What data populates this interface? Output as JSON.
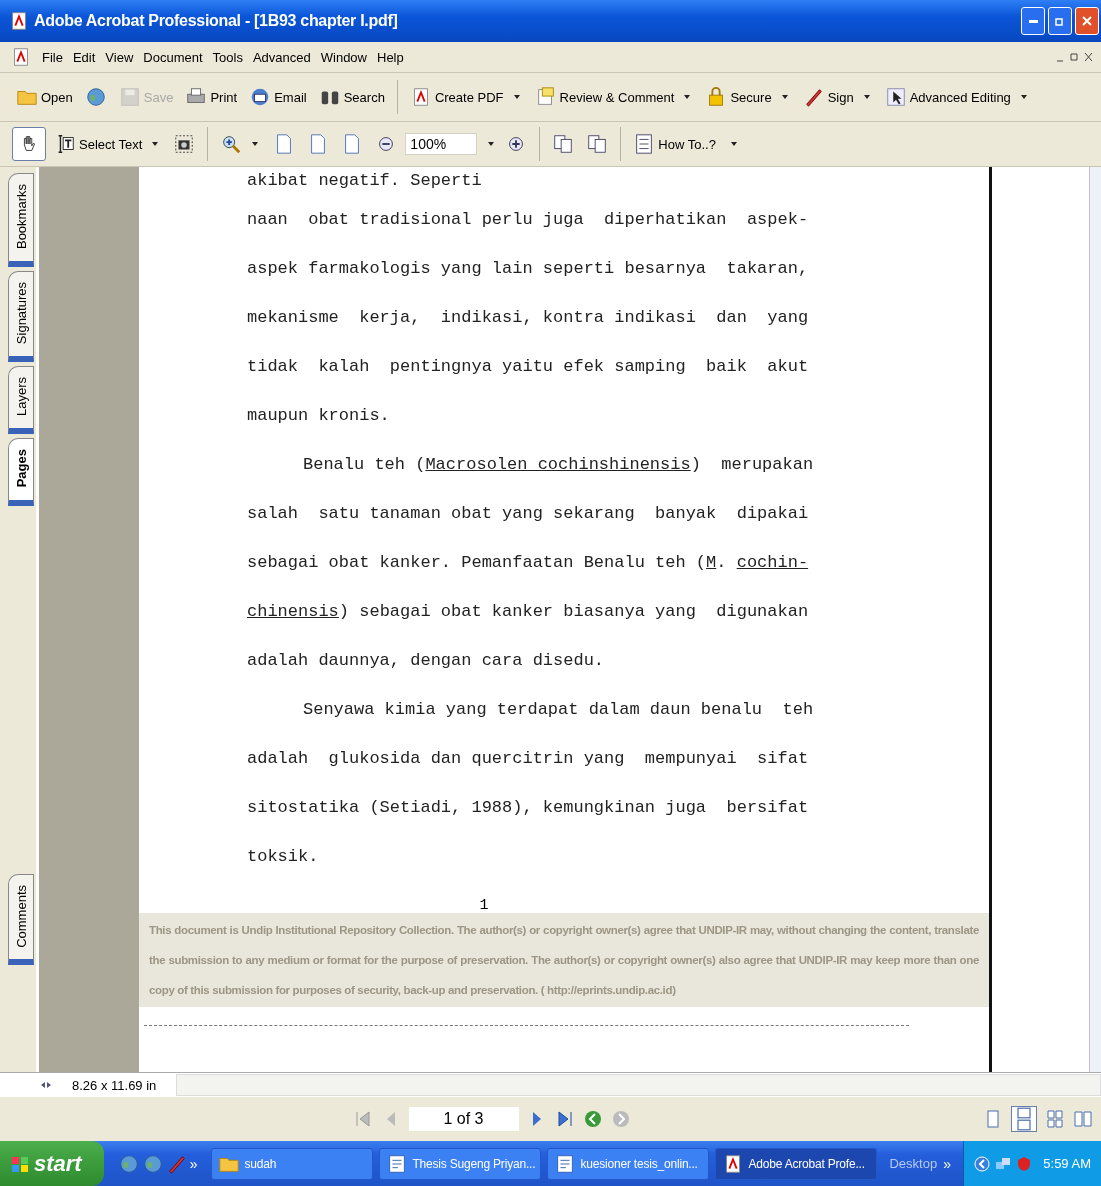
{
  "window": {
    "title": "Adobe Acrobat Professional - [1B93 chapter I.pdf]"
  },
  "menu": [
    "File",
    "Edit",
    "View",
    "Document",
    "Tools",
    "Advanced",
    "Window",
    "Help"
  ],
  "toolbar": [
    {
      "label": "Open",
      "disabled": false,
      "dropdown": false
    },
    {
      "disabled": false,
      "dropdown": false
    },
    {
      "label": "Save",
      "disabled": true,
      "dropdown": false
    },
    {
      "label": "Print",
      "disabled": false,
      "dropdown": false
    },
    {
      "label": "Email",
      "disabled": false,
      "dropdown": false
    },
    {
      "label": "Search",
      "disabled": false,
      "dropdown": false
    },
    {
      "label": "Create PDF",
      "disabled": false,
      "dropdown": true
    },
    {
      "label": "Review & Comment",
      "disabled": false,
      "dropdown": true
    },
    {
      "label": "Secure",
      "disabled": false,
      "dropdown": true
    },
    {
      "label": "Sign",
      "disabled": false,
      "dropdown": true
    },
    {
      "label": "Advanced Editing",
      "disabled": false,
      "dropdown": true
    }
  ],
  "tools": [
    {
      "selected": true,
      "dropdown": false
    },
    {
      "label": "Select Text",
      "selected": false,
      "dropdown": true
    },
    {
      "selected": false,
      "dropdown": false
    },
    {
      "selected": false,
      "dropdown": true
    },
    {
      "selected": false,
      "dropdown": false
    },
    {
      "selected": false,
      "dropdown": false
    },
    {
      "selected": false,
      "dropdown": false
    },
    {
      "selected": false,
      "dropdown": false
    }
  ],
  "zoom": {
    "value": "100%"
  },
  "how_to": {
    "label": "How To..?"
  },
  "side_tabs": [
    {
      "label": "Bookmarks",
      "selected": false
    },
    {
      "label": "Signatures",
      "selected": false
    },
    {
      "label": "Layers",
      "selected": false
    },
    {
      "label": "Pages",
      "selected": true
    },
    {
      "label": "Comments",
      "selected": false
    }
  ],
  "document": {
    "lines": [
      {
        "indent": false,
        "parts": [
          {
            "text": "akibat negatif. Seperti",
            "underlined": false
          }
        ]
      },
      {
        "indent": false,
        "parts": [
          {
            "text": "naan  obat tradisional perlu juga  diperhatikan  aspek-",
            "underlined": false
          }
        ]
      },
      {
        "indent": false,
        "parts": [
          {
            "text": "aspek farmakologis yang lain seperti besarnya  takaran,",
            "underlined": false
          }
        ]
      },
      {
        "indent": false,
        "parts": [
          {
            "text": "mekanisme  kerja,  indikasi, kontra indikasi  dan  yang",
            "underlined": false
          }
        ]
      },
      {
        "indent": false,
        "parts": [
          {
            "text": "tidak  kalah  pentingnya yaitu efek samping  baik  akut",
            "underlined": false
          }
        ]
      },
      {
        "indent": false,
        "parts": [
          {
            "text": "maupun kronis.",
            "underlined": false
          }
        ]
      },
      {
        "indent": true,
        "parts": [
          {
            "text": "Benalu teh (",
            "underlined": false
          },
          {
            "text": "Macrosolen cochinshinensis",
            "underlined": true
          },
          {
            "text": ")  merupakan",
            "underlined": false
          }
        ]
      },
      {
        "indent": false,
        "parts": [
          {
            "text": "salah  satu tanaman obat yang sekarang  banyak  dipakai",
            "underlined": false
          }
        ]
      },
      {
        "indent": false,
        "parts": [
          {
            "text": "sebagai obat kanker. Pemanfaatan Benalu teh (",
            "underlined": false
          },
          {
            "text": "M",
            "underlined": true
          },
          {
            "text": ". ",
            "underlined": false
          },
          {
            "text": "cochin-",
            "underlined": true
          }
        ]
      },
      {
        "indent": false,
        "parts": [
          {
            "text": "chinensis",
            "underlined": true
          },
          {
            "text": ") sebagai obat kanker biasanya yang  digunakan",
            "underlined": false
          }
        ]
      },
      {
        "indent": false,
        "parts": [
          {
            "text": "adalah daunnya, dengan cara disedu.",
            "underlined": false
          }
        ]
      },
      {
        "indent": true,
        "parts": [
          {
            "text": "Senyawa kimia yang terdapat dalam daun benalu  teh",
            "underlined": false
          }
        ]
      },
      {
        "indent": false,
        "parts": [
          {
            "text": "adalah  glukosida dan quercitrin yang  mempunyai  sifat",
            "underlined": false
          }
        ]
      },
      {
        "indent": false,
        "parts": [
          {
            "text": "sitostatika (Setiadi, 1988), kemungkinan juga  bersifat",
            "underlined": false
          }
        ]
      },
      {
        "indent": false,
        "parts": [
          {
            "text": "toksik.",
            "underlined": false
          }
        ]
      }
    ],
    "page_number": "1",
    "footer": "This document is Undip Institutional Repository Collection.  The author(s) or copyright owner(s) agree that UNDIP-IR may, without changing the content, translate the submission to any medium or format for the purpose of preservation. The author(s) or copyright owner(s) also agree that UNDIP-IR may keep more than one copy of this submission for purposes of security, back-up and preservation. ( http://eprints.undip.ac.id)"
  },
  "page_size": "8.26 x 11.69 in",
  "page_field": {
    "value": "1 of 3"
  },
  "taskbar": {
    "start": "start",
    "quick_launch_more": "»",
    "tasks": [
      {
        "label": "sudah",
        "selected": false
      },
      {
        "label": "Thesis Sugeng Priyan...",
        "selected": false
      },
      {
        "label": "kuesioner tesis_onlin...",
        "selected": false
      },
      {
        "label": "Adobe Acrobat Profe...",
        "selected": true
      }
    ],
    "desktop": "Desktop",
    "desktop_more": "»",
    "clock": "5:59 AM"
  }
}
